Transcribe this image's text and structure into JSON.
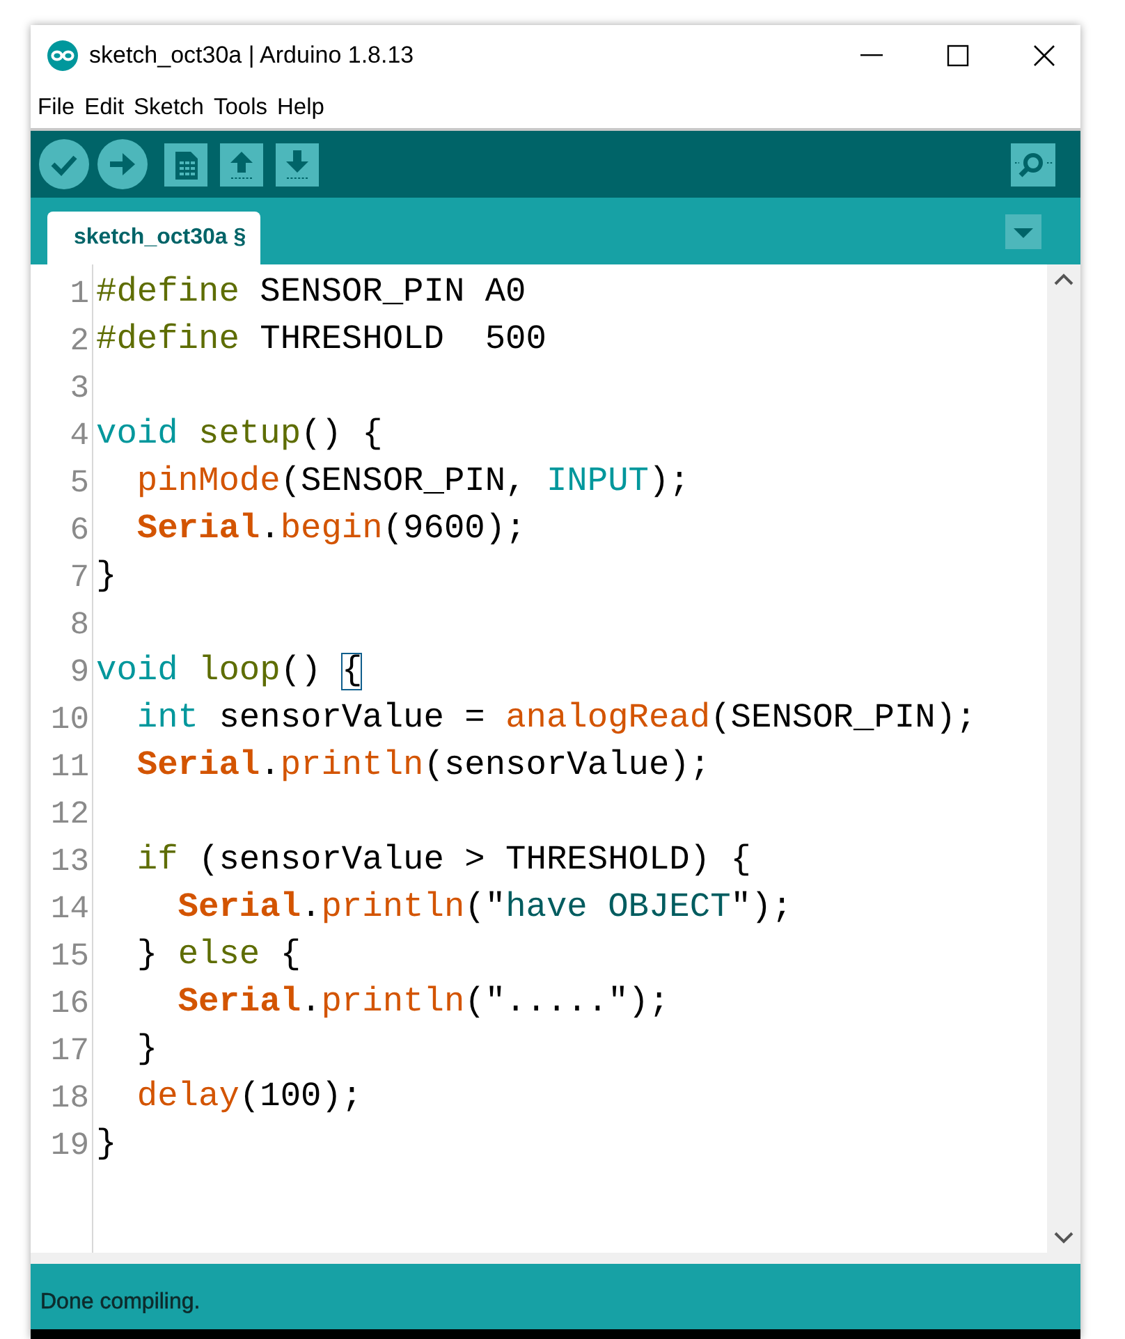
{
  "window": {
    "title": "sketch_oct30a | Arduino 1.8.13"
  },
  "menu": [
    "File",
    "Edit",
    "Sketch",
    "Tools",
    "Help"
  ],
  "tabs": [
    {
      "label": "sketch_oct30a §",
      "selected": true
    }
  ],
  "editor": {
    "lines": [
      {
        "number": "1",
        "tokens": [
          {
            "kind": "directive",
            "text": "#define"
          },
          {
            "kind": "plain",
            "text": " SENSOR_PIN A0"
          }
        ]
      },
      {
        "number": "2",
        "tokens": [
          {
            "kind": "directive",
            "text": "#define"
          },
          {
            "kind": "plain",
            "text": " THRESHOLD  500"
          }
        ]
      },
      {
        "number": "3"
      },
      {
        "number": "4",
        "tokens": [
          {
            "kind": "keyword",
            "text": "void"
          },
          {
            "kind": "control",
            "text": " setup"
          },
          {
            "kind": "plain",
            "text": "() {"
          }
        ]
      },
      {
        "number": "5",
        "tokens": [
          {
            "kind": "function",
            "text": "  pinMode"
          },
          {
            "kind": "plain",
            "text": "(SENSOR_PIN, "
          },
          {
            "kind": "keyword",
            "text": "INPUT"
          },
          {
            "kind": "plain",
            "text": ");"
          }
        ]
      },
      {
        "number": "6",
        "tokens": [
          {
            "kind": "class",
            "text": "  Serial"
          },
          {
            "kind": "plain",
            "text": "."
          },
          {
            "kind": "function",
            "text": "begin"
          },
          {
            "kind": "plain",
            "text": "(9600);"
          }
        ]
      },
      {
        "number": "7",
        "tokens": [
          {
            "kind": "plain",
            "text": "}"
          }
        ]
      },
      {
        "number": "8"
      },
      {
        "number": "9",
        "tokens": [
          {
            "kind": "keyword",
            "text": "void"
          },
          {
            "kind": "control",
            "text": " loop"
          },
          {
            "kind": "plain",
            "text": "() "
          },
          {
            "kind": "matched_brace",
            "text": "{"
          }
        ]
      },
      {
        "number": "10",
        "tokens": [
          {
            "kind": "keyword",
            "text": "  int"
          },
          {
            "kind": "plain",
            "text": " sensorValue = "
          },
          {
            "kind": "function",
            "text": "analogRead"
          },
          {
            "kind": "plain",
            "text": "(SENSOR_PIN);"
          }
        ]
      },
      {
        "number": "11",
        "tokens": [
          {
            "kind": "class",
            "text": "  Serial"
          },
          {
            "kind": "plain",
            "text": "."
          },
          {
            "kind": "function",
            "text": "println"
          },
          {
            "kind": "plain",
            "text": "(sensorValue);"
          }
        ]
      },
      {
        "number": "12"
      },
      {
        "number": "13",
        "tokens": [
          {
            "kind": "control",
            "text": "  if"
          },
          {
            "kind": "plain",
            "text": " (sensorValue > THRESHOLD) {"
          }
        ]
      },
      {
        "number": "14",
        "tokens": [
          {
            "kind": "class",
            "text": "    Serial"
          },
          {
            "kind": "plain",
            "text": "."
          },
          {
            "kind": "function",
            "text": "println"
          },
          {
            "kind": "plain",
            "text": "(\""
          },
          {
            "kind": "string",
            "text": "have OBJECT"
          },
          {
            "kind": "plain",
            "text": "\");"
          }
        ]
      },
      {
        "number": "15",
        "tokens": [
          {
            "kind": "plain",
            "text": "  } "
          },
          {
            "kind": "control",
            "text": "else"
          },
          {
            "kind": "plain",
            "text": " {"
          }
        ]
      },
      {
        "number": "16",
        "tokens": [
          {
            "kind": "class",
            "text": "    Serial"
          },
          {
            "kind": "plain",
            "text": "."
          },
          {
            "kind": "function",
            "text": "println"
          },
          {
            "kind": "plain",
            "text": "(\".....\");"
          }
        ]
      },
      {
        "number": "17",
        "tokens": [
          {
            "kind": "plain",
            "text": "  }"
          }
        ]
      },
      {
        "number": "18",
        "tokens": [
          {
            "kind": "function",
            "text": "  delay"
          },
          {
            "kind": "plain",
            "text": "(100);"
          }
        ]
      },
      {
        "number": "19",
        "tokens": [
          {
            "kind": "plain",
            "text": "}"
          }
        ]
      }
    ]
  },
  "status": "Done compiling."
}
